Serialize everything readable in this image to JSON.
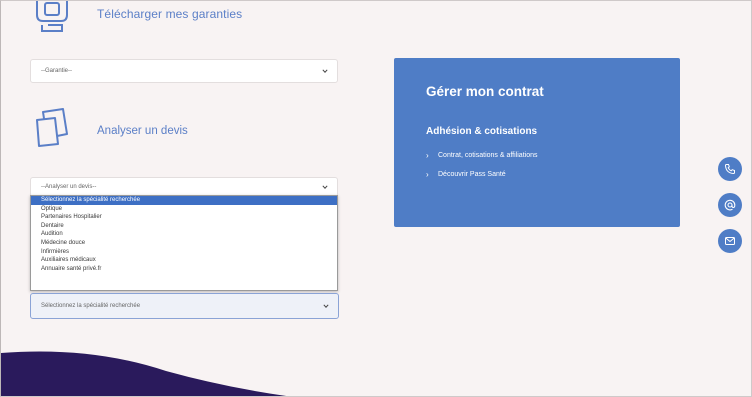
{
  "garanties": {
    "download_label": "Télécharger mes garanties",
    "select_value": "--Garantie--"
  },
  "devis": {
    "label": "Analyser un devis",
    "select_value": "--Analyser un devis--"
  },
  "specialite": {
    "select_value": "Sélectionnez la spécialité recherchée",
    "options": [
      "Sélectionnez la spécialité recherchée",
      "Optique",
      "Partenaires Hospitalier",
      "Dentaire",
      "Audition",
      "Médecine douce",
      "Infirmières",
      "Auxiliaires médicaux",
      "Annuaire santé privé.fr"
    ]
  },
  "contrat": {
    "title": "Gérer mon contrat",
    "subtitle": "Adhésion & cotisations",
    "links": [
      "Contrat, cotisations & affiliations",
      "Découvrir Pass Santé"
    ]
  },
  "contact_buttons": [
    "phone-icon",
    "at-icon",
    "mail-icon"
  ],
  "colors": {
    "accent": "#4f7dc6",
    "background": "#f8f3f3",
    "wave": "#2a1a5c"
  }
}
